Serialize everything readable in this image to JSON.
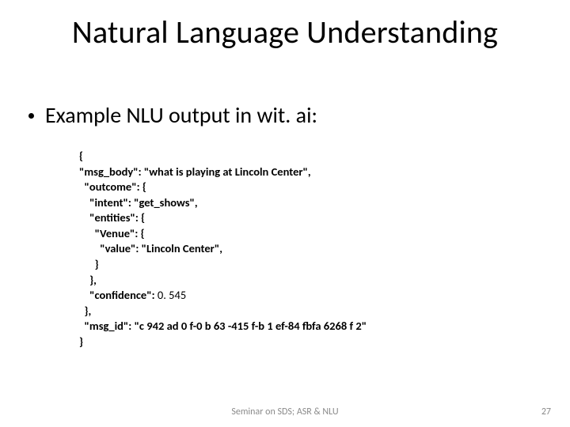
{
  "title": "Natural Language Understanding",
  "bullet": "Example NLU output in wit. ai:",
  "code": {
    "l1": "{",
    "l2": "\"msg_body\": \"what is playing at Lincoln Center\",",
    "l3": "  \"outcome\": {",
    "l4": "    \"intent\": \"get_shows\",",
    "l5": "    \"entities\": {",
    "l6": "      \"Venue\": {",
    "l7": "        \"value\": \"Lincoln Center\",",
    "l8": "      }",
    "l9": "    },",
    "l10a": "    \"confidence\": ",
    "l10b": "0. 545",
    "l11": "  },",
    "l12": "  \"msg_id\": \"c 942 ad 0 f-0 b 63 -415 f-b 1 ef-84 fbfa 6268 f 2\"",
    "l13": "}"
  },
  "footer": "Seminar on SDS; ASR & NLU",
  "page": "27"
}
